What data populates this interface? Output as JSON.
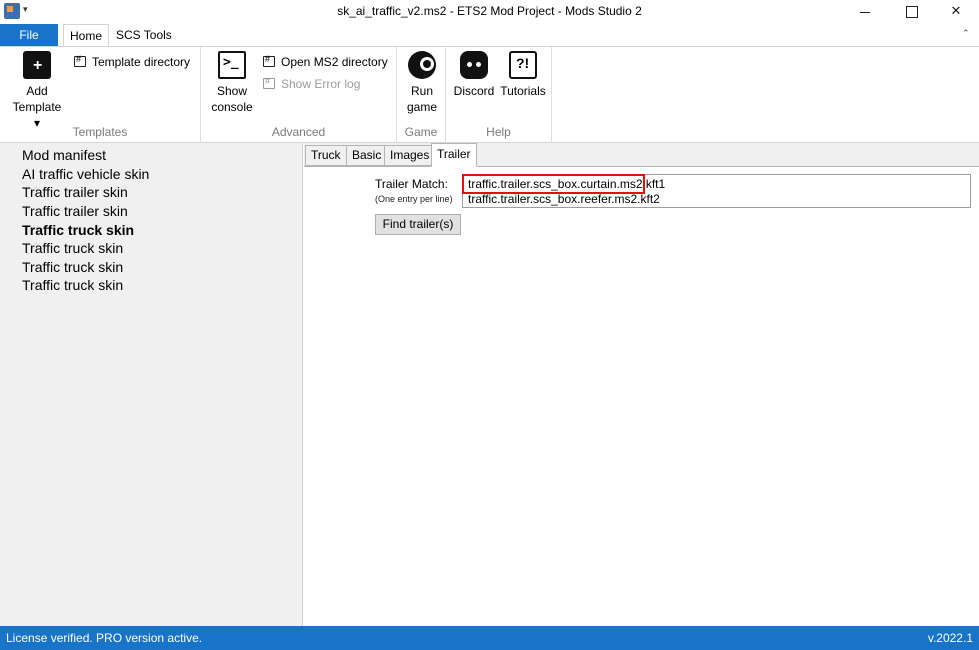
{
  "window": {
    "title": "sk_ai_traffic_v2.ms2  -  ETS2 Mod Project  -  Mods Studio 2"
  },
  "ribbon_tabs": {
    "file": "File",
    "home": "Home",
    "scs_tools": "SCS Tools"
  },
  "ribbon": {
    "templates": {
      "label": "Templates",
      "add_template_line1": "Add",
      "add_template_line2": "Template ▾",
      "template_directory": "Template directory"
    },
    "advanced": {
      "label": "Advanced",
      "show_console_line1": "Show",
      "show_console_line2": "console",
      "open_ms2_directory": "Open MS2 directory",
      "show_error_log": "Show Error log"
    },
    "game": {
      "label": "Game",
      "run_game_line1": "Run",
      "run_game_line2": "game"
    },
    "help": {
      "label": "Help",
      "discord": "Discord",
      "tutorials": "Tutorials"
    }
  },
  "project_items": [
    "Mod manifest",
    "AI traffic vehicle skin",
    "Traffic trailer skin",
    "Traffic trailer skin",
    "Traffic truck skin",
    "Traffic truck skin",
    "Traffic truck skin",
    "Traffic truck skin"
  ],
  "selected_item_index": 4,
  "editor_tabs": [
    "Truck",
    "Basic",
    "Images",
    "Trailer"
  ],
  "active_editor_tab": "Trailer",
  "trailer": {
    "match_label": "Trailer Match:",
    "match_hint": "(One entry per line)",
    "entries": [
      "traffic.trailer.scs_box.curtain.ms2.kft1",
      "traffic.trailer.scs_box.reefer.ms2.kft2"
    ],
    "find_button": "Find trailer(s)"
  },
  "status": {
    "license": "License verified. PRO version active.",
    "version": "v.2022.1"
  },
  "colors": {
    "accent": "#1874c8",
    "highlight": "#e01010"
  }
}
